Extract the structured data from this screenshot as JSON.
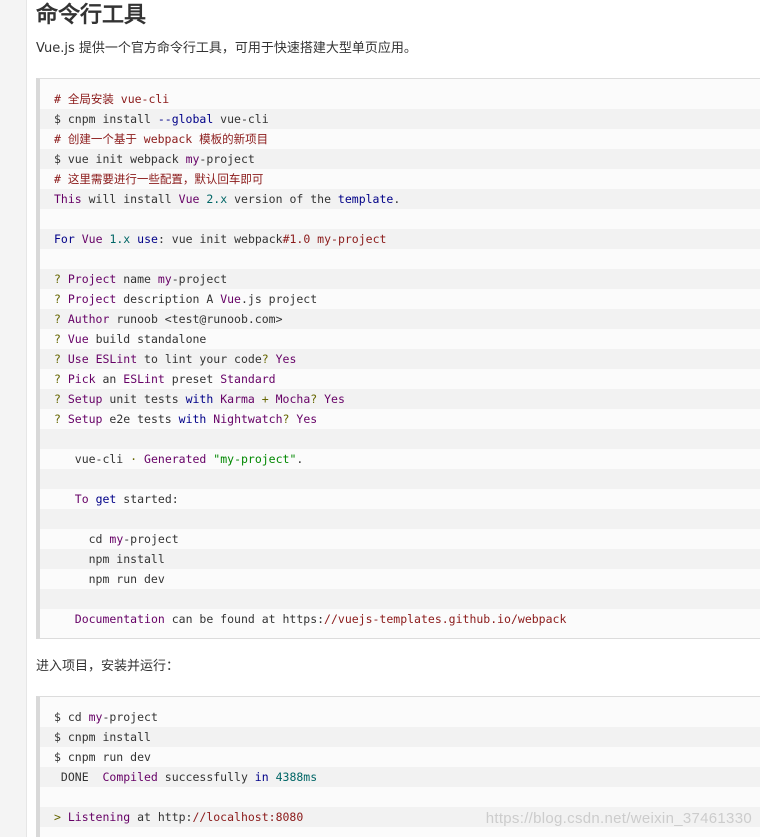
{
  "heading": "命令行工具",
  "intro": "Vue.js 提供一个官方命令行工具，可用于快速搭建大型单页应用。",
  "between_text": "进入项目，安装并运行：",
  "watermark": "https://blog.csdn.net/weixin_37461330",
  "code_block_1": [
    [
      {
        "t": "# 全局安装 vue-cli",
        "c": "c"
      }
    ],
    [
      {
        "t": "$ cnpm install ",
        "c": ""
      },
      {
        "t": "--global",
        "c": "k"
      },
      {
        "t": " vue-cli",
        "c": ""
      }
    ],
    [
      {
        "t": "# 创建一个基于 webpack 模板的新项目",
        "c": "c"
      }
    ],
    [
      {
        "t": "$ vue init webpack ",
        "c": ""
      },
      {
        "t": "my",
        "c": "t"
      },
      {
        "t": "-project",
        "c": ""
      }
    ],
    [
      {
        "t": "# 这里需要进行一些配置，默认回车即可",
        "c": "c"
      }
    ],
    [
      {
        "t": "This",
        "c": "t"
      },
      {
        "t": " will install ",
        "c": ""
      },
      {
        "t": "Vue",
        "c": "t"
      },
      {
        "t": " ",
        "c": ""
      },
      {
        "t": "2.x",
        "c": "n"
      },
      {
        "t": " version of the ",
        "c": ""
      },
      {
        "t": "template",
        "c": "k"
      },
      {
        "t": ".",
        "c": ""
      }
    ],
    [
      {
        "t": "",
        "c": ""
      }
    ],
    [
      {
        "t": "For",
        "c": "k"
      },
      {
        "t": " ",
        "c": ""
      },
      {
        "t": "Vue",
        "c": "t"
      },
      {
        "t": " ",
        "c": ""
      },
      {
        "t": "1.x",
        "c": "n"
      },
      {
        "t": " ",
        "c": ""
      },
      {
        "t": "use",
        "c": "k"
      },
      {
        "t": ": vue init webpack",
        "c": ""
      },
      {
        "t": "#1.0 my-project",
        "c": "c"
      }
    ],
    [
      {
        "t": "",
        "c": ""
      }
    ],
    [
      {
        "t": "? ",
        "c": "p2"
      },
      {
        "t": "Project",
        "c": "t"
      },
      {
        "t": " name ",
        "c": ""
      },
      {
        "t": "my",
        "c": "t"
      },
      {
        "t": "-project",
        "c": ""
      }
    ],
    [
      {
        "t": "? ",
        "c": "p2"
      },
      {
        "t": "Project",
        "c": "t"
      },
      {
        "t": " description A ",
        "c": ""
      },
      {
        "t": "Vue",
        "c": "t"
      },
      {
        "t": ".js project",
        "c": ""
      }
    ],
    [
      {
        "t": "? ",
        "c": "p2"
      },
      {
        "t": "Author",
        "c": "t"
      },
      {
        "t": " runoob <test@runoob.com>",
        "c": ""
      }
    ],
    [
      {
        "t": "? ",
        "c": "p2"
      },
      {
        "t": "Vue",
        "c": "t"
      },
      {
        "t": " build standalone",
        "c": ""
      }
    ],
    [
      {
        "t": "? ",
        "c": "p2"
      },
      {
        "t": "Use",
        "c": "t"
      },
      {
        "t": " ",
        "c": ""
      },
      {
        "t": "ESLint",
        "c": "t"
      },
      {
        "t": " to lint your code",
        "c": ""
      },
      {
        "t": "?",
        "c": "p2"
      },
      {
        "t": " ",
        "c": ""
      },
      {
        "t": "Yes",
        "c": "t"
      }
    ],
    [
      {
        "t": "? ",
        "c": "p2"
      },
      {
        "t": "Pick",
        "c": "t"
      },
      {
        "t": " an ",
        "c": ""
      },
      {
        "t": "ESLint",
        "c": "t"
      },
      {
        "t": " preset ",
        "c": ""
      },
      {
        "t": "Standard",
        "c": "t"
      }
    ],
    [
      {
        "t": "? ",
        "c": "p2"
      },
      {
        "t": "Setup",
        "c": "t"
      },
      {
        "t": " unit tests ",
        "c": ""
      },
      {
        "t": "with",
        "c": "k"
      },
      {
        "t": " ",
        "c": ""
      },
      {
        "t": "Karma",
        "c": "t"
      },
      {
        "t": " + ",
        "c": "p2"
      },
      {
        "t": "Mocha",
        "c": "t"
      },
      {
        "t": "?",
        "c": "p2"
      },
      {
        "t": " ",
        "c": ""
      },
      {
        "t": "Yes",
        "c": "t"
      }
    ],
    [
      {
        "t": "? ",
        "c": "p2"
      },
      {
        "t": "Setup",
        "c": "t"
      },
      {
        "t": " e2e tests ",
        "c": ""
      },
      {
        "t": "with",
        "c": "k"
      },
      {
        "t": " ",
        "c": ""
      },
      {
        "t": "Nightwatch",
        "c": "t"
      },
      {
        "t": "?",
        "c": "p2"
      },
      {
        "t": " ",
        "c": ""
      },
      {
        "t": "Yes",
        "c": "t"
      }
    ],
    [
      {
        "t": "",
        "c": ""
      }
    ],
    [
      {
        "t": "   vue-cli ",
        "c": ""
      },
      {
        "t": "·",
        "c": "p2"
      },
      {
        "t": " ",
        "c": ""
      },
      {
        "t": "Generated",
        "c": "t"
      },
      {
        "t": " ",
        "c": ""
      },
      {
        "t": "\"my-project\"",
        "c": "s"
      },
      {
        "t": ".",
        "c": ""
      }
    ],
    [
      {
        "t": "",
        "c": ""
      }
    ],
    [
      {
        "t": "   ",
        "c": ""
      },
      {
        "t": "To",
        "c": "t"
      },
      {
        "t": " ",
        "c": ""
      },
      {
        "t": "get",
        "c": "k"
      },
      {
        "t": " started:",
        "c": ""
      }
    ],
    [
      {
        "t": "",
        "c": ""
      }
    ],
    [
      {
        "t": "     cd ",
        "c": ""
      },
      {
        "t": "my",
        "c": "t"
      },
      {
        "t": "-project",
        "c": ""
      }
    ],
    [
      {
        "t": "     npm install",
        "c": ""
      }
    ],
    [
      {
        "t": "     npm run dev",
        "c": ""
      }
    ],
    [
      {
        "t": "",
        "c": ""
      }
    ],
    [
      {
        "t": "   ",
        "c": ""
      },
      {
        "t": "Documentation",
        "c": "t"
      },
      {
        "t": " can be found at https:",
        "c": ""
      },
      {
        "t": "//vuejs-templates.github.io/webpack",
        "c": "c"
      }
    ]
  ],
  "code_block_2": [
    [
      {
        "t": "$ cd ",
        "c": ""
      },
      {
        "t": "my",
        "c": "t"
      },
      {
        "t": "-project",
        "c": ""
      }
    ],
    [
      {
        "t": "$ cnpm install",
        "c": ""
      }
    ],
    [
      {
        "t": "$ cnpm run dev",
        "c": ""
      }
    ],
    [
      {
        "t": " DONE  ",
        "c": ""
      },
      {
        "t": "Compiled",
        "c": "t"
      },
      {
        "t": " successfully ",
        "c": ""
      },
      {
        "t": "in",
        "c": "k"
      },
      {
        "t": " ",
        "c": ""
      },
      {
        "t": "4388ms",
        "c": "n"
      }
    ],
    [
      {
        "t": "",
        "c": ""
      }
    ],
    [
      {
        "t": "> ",
        "c": "p2"
      },
      {
        "t": "Listening",
        "c": "t"
      },
      {
        "t": " at http:",
        "c": ""
      },
      {
        "t": "//localhost:8080",
        "c": "c"
      }
    ]
  ]
}
